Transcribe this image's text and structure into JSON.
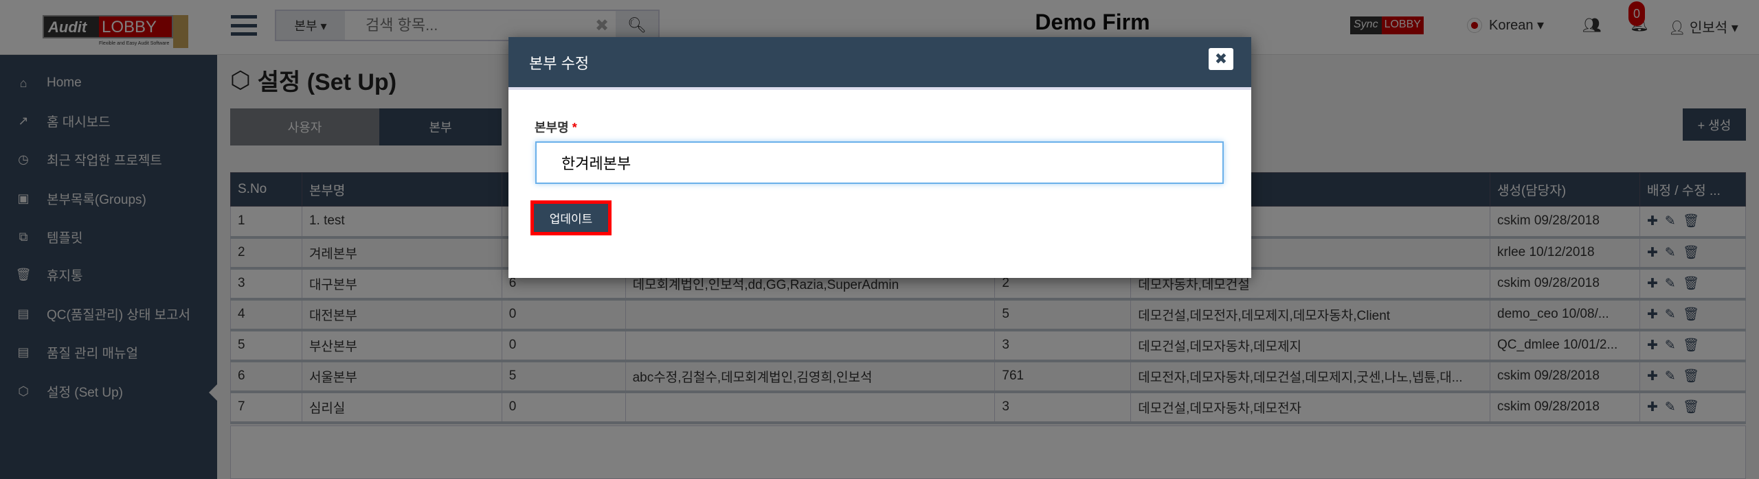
{
  "header": {
    "logo_text": "Audit LOBBY",
    "logo_sub": "Flexible and Easy Audit Software",
    "search_scope": "본부 ▾",
    "search_placeholder": "검색 항목...",
    "firm": "Demo Firm",
    "sync_logo": "Sync LOBBY",
    "language": "Korean ▾",
    "notifications": "0",
    "user": "인보석 ▾"
  },
  "sidebar": {
    "items": [
      {
        "icon": "home-icon",
        "glyph": "⌂",
        "label": "Home"
      },
      {
        "icon": "chart-icon",
        "glyph": "📈",
        "label": "홈 대시보드"
      },
      {
        "icon": "clock-icon",
        "glyph": "◷",
        "label": "최근 작업한 프로젝트"
      },
      {
        "icon": "group-icon",
        "glyph": "▣",
        "label": "본부목록(Groups)"
      },
      {
        "icon": "template-icon",
        "glyph": "⧉",
        "label": "템플릿"
      },
      {
        "icon": "trash-icon",
        "glyph": "🗑",
        "label": "휴지통"
      },
      {
        "icon": "report-icon",
        "glyph": "▤",
        "label": "QC(품질관리) 상태 보고서"
      },
      {
        "icon": "manual-icon",
        "glyph": "▤",
        "label": "품질 관리 매뉴얼"
      },
      {
        "icon": "setup-icon",
        "glyph": "⬡",
        "label": "설정 (Set Up)"
      }
    ]
  },
  "page": {
    "title": "설정 (Set Up)",
    "tabs": [
      "사용자",
      "본부"
    ],
    "create": "+ 생성"
  },
  "table": {
    "headers": [
      "S.No",
      "본부명",
      "",
      "",
      "",
      "",
      "생성(담당자)",
      "배정 / 수정 ..."
    ],
    "rows": [
      [
        "1",
        "1. test",
        "",
        "",
        "",
        "",
        "cskim 09/28/2018"
      ],
      [
        "2",
        "겨레본부",
        "",
        "",
        "",
        "",
        "krlee 10/12/2018"
      ],
      [
        "3",
        "대구본부",
        "6",
        "데모회계법인,인보석,dd,GG,Razia,SuperAdmin",
        "2",
        "데모자동차,데모건설",
        "cskim 09/28/2018"
      ],
      [
        "4",
        "대전본부",
        "0",
        "",
        "5",
        "데모건설,데모전자,데모제지,데모자동차,Client",
        "demo_ceo 10/08/..."
      ],
      [
        "5",
        "부산본부",
        "0",
        "",
        "3",
        "데모건설,데모자동차,데모제지",
        "QC_dmlee 10/01/2..."
      ],
      [
        "6",
        "서울본부",
        "5",
        "abc수정,김철수,데모회계법인,김영희,인보석",
        "761",
        "데모전자,데모자동차,데모건설,데모제지,굿센,나노,넵튠,대...",
        "cskim 09/28/2018"
      ],
      [
        "7",
        "심리실",
        "0",
        "",
        "3",
        "데모건설,데모자동차,데모전자",
        "cskim 09/28/2018"
      ]
    ],
    "actions": "✚ ✎ 🗑"
  },
  "modal": {
    "title": "본부 수정",
    "close": "✖",
    "field_label": "본부명",
    "required": "*",
    "field_value": "한겨레본부",
    "update": "업데이트"
  }
}
